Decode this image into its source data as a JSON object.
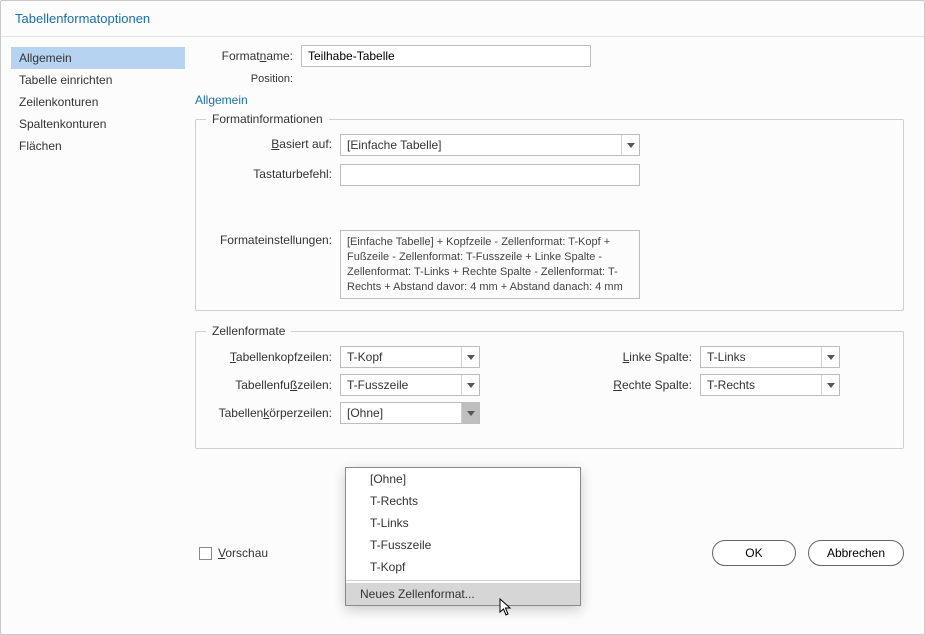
{
  "title": "Tabellenformatoptionen",
  "sidebar": {
    "items": [
      {
        "label": "Allgemein"
      },
      {
        "label": "Tabelle einrichten"
      },
      {
        "label": "Zeilenkonturen"
      },
      {
        "label": "Spaltenkonturen"
      },
      {
        "label": "Flächen"
      }
    ],
    "active_index": 0
  },
  "header": {
    "formatname_label_pre": "Format",
    "formatname_label_u": "n",
    "formatname_label_post": "ame:",
    "formatname_value": "Teilhabe-Tabelle",
    "position_label": "Position:"
  },
  "section_allgemein_label": "Allgemein",
  "formatinfo": {
    "legend": "Formatinformationen",
    "basiert_label_pre": "",
    "basiert_label_u": "B",
    "basiert_label_post": "asiert auf:",
    "basiert_value": "[Einfache Tabelle]",
    "tastatur_label": "Tastaturbefehl:",
    "tastatur_value": "",
    "einstellungen_label": "Formateinstellungen:",
    "einstellungen_value": "[Einfache Tabelle] + Kopfzeile - Zellenformat: T-Kopf + Fußzeile - Zellenformat: T-Fusszeile + Linke Spalte - Zellenformat: T-Links + Rechte Spalte - Zellenformat: T-Rechts + Abstand davor: 4 mm + Abstand danach: 4 mm"
  },
  "zellen": {
    "legend": "Zellenformate",
    "kopf_label_u": "T",
    "kopf_label_post": "abellenkopfzeilen:",
    "kopf_value": "T-Kopf",
    "fuss_label_pre": "Tabellenfu",
    "fuss_label_u": "ß",
    "fuss_label_post": "zeilen:",
    "fuss_value": "T-Fusszeile",
    "koerper_label_pre": "Tabellen",
    "koerper_label_u": "k",
    "koerper_label_post": "örperzeilen:",
    "koerper_value": "[Ohne]",
    "linke_label_u": "L",
    "linke_label_post": "inke Spalte:",
    "linke_value": "T-Links",
    "rechte_label_u": "R",
    "rechte_label_post": "echte Spalte:",
    "rechte_value": "T-Rechts"
  },
  "dropdown": {
    "options": [
      {
        "label": "[Ohne]"
      },
      {
        "label": "T-Rechts"
      },
      {
        "label": "T-Links"
      },
      {
        "label": "T-Fusszeile"
      },
      {
        "label": "T-Kopf"
      }
    ],
    "new_label": "Neues Zellenformat..."
  },
  "footer": {
    "vorschau_u": "V",
    "vorschau_post": "orschau",
    "ok": "OK",
    "cancel": "Abbrechen"
  }
}
